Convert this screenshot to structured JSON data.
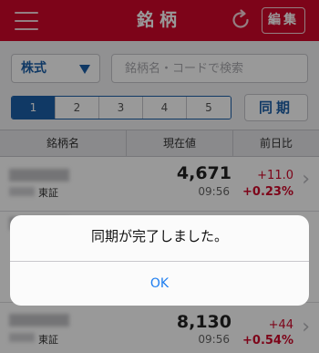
{
  "header": {
    "title": "銘柄",
    "menu_icon": "hamburger-menu-icon",
    "refresh_icon": "refresh-icon",
    "edit_label": "編集"
  },
  "controls": {
    "type_select": "株式",
    "search_placeholder": "銘柄名・コードで検索",
    "pages": [
      "1",
      "2",
      "3",
      "4",
      "5"
    ],
    "active_page": "1",
    "sync_label": "同期"
  },
  "table": {
    "headers": {
      "name": "銘柄名",
      "price": "現在値",
      "change": "前日比"
    },
    "rows": [
      {
        "exchange": "東証",
        "price": "4,671",
        "time": "09:56",
        "change": "+11.0",
        "change_pct": "+0.23%"
      },
      {
        "exchange": "",
        "price": "",
        "time": "",
        "change": "",
        "change_pct": ""
      },
      {
        "exchange": "東証",
        "price": "8,130",
        "time": "09:56",
        "change": "+44",
        "change_pct": "+0.54%"
      }
    ]
  },
  "alert": {
    "message": "同期が完了しました。",
    "ok_label": "OK"
  },
  "colors": {
    "brand_red": "#d0082a",
    "accent_blue": "#1b5fa8",
    "positive_red": "#d0082a",
    "ios_link_blue": "#1e7ef0"
  }
}
